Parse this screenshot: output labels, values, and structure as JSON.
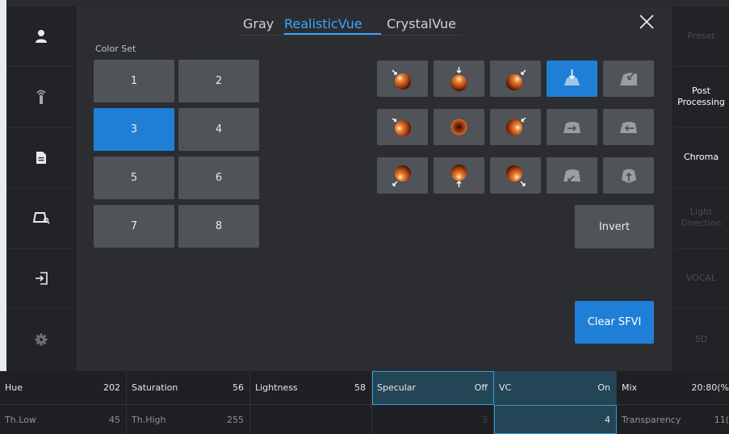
{
  "tabs": [
    {
      "label": "Gray",
      "active": false
    },
    {
      "label": "RealisticVue",
      "active": true
    },
    {
      "label": "CrystalVue",
      "active": false
    }
  ],
  "left_sidebar": [
    {
      "icon": "patient-icon"
    },
    {
      "icon": "probe-icon"
    },
    {
      "icon": "report-icon"
    },
    {
      "icon": "image-review-icon"
    },
    {
      "icon": "exit-icon"
    },
    {
      "icon": "settings-icon"
    }
  ],
  "color_set": {
    "label": "Color Set",
    "buttons": [
      "1",
      "2",
      "3",
      "4",
      "5",
      "6",
      "7",
      "8"
    ],
    "selected": "3"
  },
  "light_direction_grid": {
    "selected_index": 3,
    "items": [
      "sphere-light-top-left-icon",
      "sphere-light-top-icon",
      "sphere-light-top-right-icon",
      "shape-light-top-icon",
      "shape-light-top-right-icon",
      "sphere-light-left-icon",
      "sphere-light-center-icon",
      "sphere-light-right-icon",
      "shape-light-left-icon",
      "shape-light-right-icon",
      "sphere-light-bottom-left-icon",
      "sphere-light-bottom-icon",
      "sphere-light-bottom-right-icon",
      "shape-light-bottom-left-icon",
      "shape-light-bottom-icon"
    ]
  },
  "invert_label": "Invert",
  "clear_sfvi_label": "Clear SFVI",
  "right_sidebar": [
    {
      "label": "Preset",
      "active": false
    },
    {
      "label": "Post Processing",
      "active": true
    },
    {
      "label": "Chroma",
      "active": true
    },
    {
      "label": "Light Direction",
      "active": false
    },
    {
      "label": "VOCAL",
      "active": false
    },
    {
      "label": "5D",
      "active": false
    }
  ],
  "params_row1": [
    {
      "label": "Hue",
      "value": "202"
    },
    {
      "label": "Saturation",
      "value": "56"
    },
    {
      "label": "Lightness",
      "value": "58"
    },
    {
      "label": "Specular",
      "value": "Off"
    },
    {
      "label": "VC",
      "value": "On"
    },
    {
      "label": "Mix",
      "value": "20:80(%"
    }
  ],
  "params_row2": [
    {
      "label": "Th.Low",
      "value": "45"
    },
    {
      "label": "Th.High",
      "value": "255"
    },
    {
      "label": "",
      "value": ""
    },
    {
      "label": "",
      "value": "3"
    },
    {
      "label": "",
      "value": "4"
    },
    {
      "label": "Transparency",
      "value": "11("
    }
  ],
  "colors": {
    "accent": "#3aa6ff",
    "selected_button": "#1f7fd6",
    "button": "#505358",
    "background": "#2c2d31",
    "highlight_cell": "#244556"
  }
}
